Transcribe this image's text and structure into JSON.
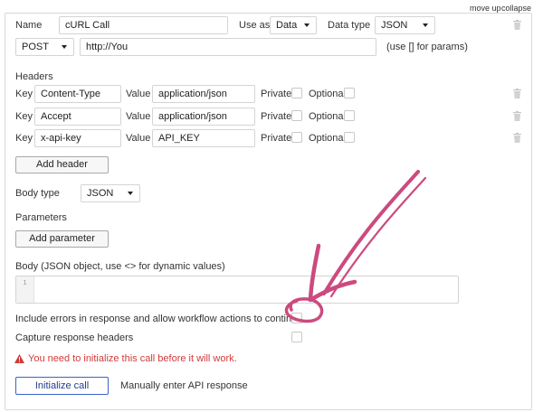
{
  "top_links": {
    "move_up": "move up",
    "collapse": "collapse"
  },
  "call": {
    "name_label": "Name",
    "name_value": "cURL Call",
    "use_as_label": "Use as",
    "use_as_value": "Data",
    "data_type_label": "Data type",
    "data_type_value": "JSON",
    "method_value": "POST",
    "url_value": "http://You",
    "params_hint": "(use [] for params)"
  },
  "headers": {
    "title": "Headers",
    "key_label": "Key",
    "value_label": "Value",
    "private_label": "Private",
    "optional_label": "Optional",
    "rows": [
      {
        "key": "Content-Type",
        "value": "application/json"
      },
      {
        "key": "Accept",
        "value": "application/json"
      },
      {
        "key": "x-api-key",
        "value": "API_KEY"
      }
    ],
    "add_button": "Add header"
  },
  "body_type": {
    "label": "Body type",
    "value": "JSON"
  },
  "parameters": {
    "title": "Parameters",
    "add_button": "Add parameter"
  },
  "body": {
    "label": "Body (JSON object, use <> for dynamic values)",
    "line_number": "1"
  },
  "options": {
    "include_errors": "Include errors in response and allow workflow actions to continue",
    "capture_headers": "Capture response headers"
  },
  "warning": {
    "text": "You need to initialize this call before it will work.",
    "color": "#d23a3a"
  },
  "actions": {
    "initialize": "Initialize call",
    "manual": "Manually enter API response"
  },
  "annotation": {
    "color": "#cc4a7f"
  }
}
